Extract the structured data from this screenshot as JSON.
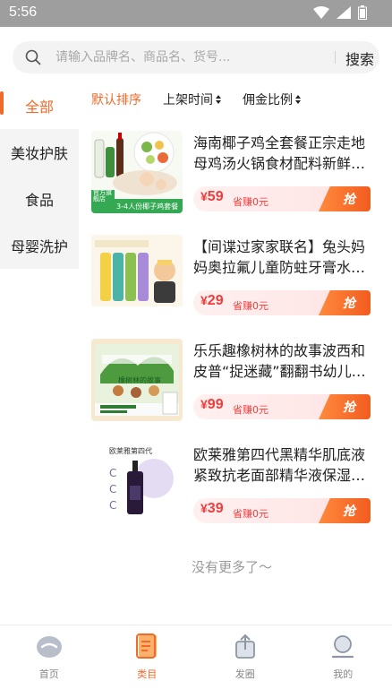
{
  "status_bar": {
    "time": "5:56"
  },
  "search": {
    "placeholder": "请输入品牌名、商品名、货号...",
    "button_label": "搜索"
  },
  "sidebar": {
    "items": [
      {
        "label": "全部",
        "active": true
      },
      {
        "label": "美妆护肤",
        "active": false
      },
      {
        "label": "食品",
        "active": false
      },
      {
        "label": "母婴洗护",
        "active": false
      }
    ]
  },
  "sort_bar": {
    "items": [
      {
        "label": "默认排序",
        "active": true
      },
      {
        "label": "上架时间",
        "active": false
      },
      {
        "label": "佣金比例",
        "active": false
      }
    ]
  },
  "products": [
    {
      "title": "海南椰子鸡全套餐正宗走地母鸡汤火锅食材配料新鲜…",
      "price_symbol": "¥",
      "price": "59",
      "earn_label": "省赚0元",
      "grab_label": "抢",
      "thumb_caption": "3-4人份椰子鸡套餐",
      "thumb_badge": "官方旗舰店"
    },
    {
      "title": "【间谍过家家联名】兔头妈妈奥拉氟儿童防蛀牙膏水…",
      "price_symbol": "¥",
      "price": "29",
      "earn_label": "省赚0元",
      "grab_label": "抢",
      "thumb_caption": "",
      "thumb_badge": ""
    },
    {
      "title": "乐乐趣橡树林的故事波西和皮普“捉迷藏”翻翻书幼儿…",
      "price_symbol": "¥",
      "price": "99",
      "earn_label": "省赚0元",
      "grab_label": "抢",
      "thumb_caption": "橡树林的故事",
      "thumb_badge": ""
    },
    {
      "title": "欧莱雅第四代黑精华肌底液紧致抗老面部精华液保湿…",
      "price_symbol": "¥",
      "price": "39",
      "earn_label": "省赚0元",
      "grab_label": "抢",
      "thumb_caption": "欧莱雅第四代",
      "thumb_badge": ""
    }
  ],
  "no_more_text": "没有更多了～",
  "bottom_nav": {
    "items": [
      {
        "label": "首页",
        "icon": "home-icon",
        "active": false
      },
      {
        "label": "类目",
        "icon": "category-icon",
        "active": true
      },
      {
        "label": "发圈",
        "icon": "share-icon",
        "active": false
      },
      {
        "label": "我的",
        "icon": "profile-icon",
        "active": false
      }
    ]
  },
  "colors": {
    "accent": "#f06a2a",
    "price": "#f03c3c",
    "status_bar": "#9e9e9e"
  }
}
